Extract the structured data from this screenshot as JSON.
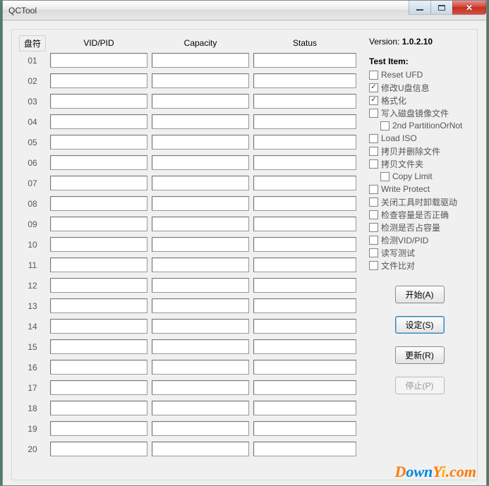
{
  "window": {
    "title": "QCTool"
  },
  "version_label": "Version:",
  "version_value": "1.0.2.10",
  "headers": {
    "drive": "盘符",
    "vidpid": "VID/PID",
    "capacity": "Capacity",
    "status": "Status"
  },
  "rows": [
    "01",
    "02",
    "03",
    "04",
    "05",
    "06",
    "07",
    "08",
    "09",
    "10",
    "11",
    "12",
    "13",
    "14",
    "15",
    "16",
    "17",
    "18",
    "19",
    "20"
  ],
  "test_header": "Test Item:",
  "checks": [
    {
      "label": "Reset UFD",
      "checked": false,
      "indent": false
    },
    {
      "label": "修改U盘信息",
      "checked": true,
      "indent": false
    },
    {
      "label": "格式化",
      "checked": true,
      "indent": false
    },
    {
      "label": "写入磁盘镜像文件",
      "checked": false,
      "indent": false
    },
    {
      "label": "2nd PartitionOrNot",
      "checked": false,
      "indent": true
    },
    {
      "label": "Load ISO",
      "checked": false,
      "indent": false
    },
    {
      "label": "拷贝并删除文件",
      "checked": false,
      "indent": false
    },
    {
      "label": "拷贝文件夹",
      "checked": false,
      "indent": false
    },
    {
      "label": "Copy Limit",
      "checked": false,
      "indent": true
    },
    {
      "label": "Write Protect",
      "checked": false,
      "indent": false
    },
    {
      "label": "关闭工具时卸载驱动",
      "checked": false,
      "indent": false
    },
    {
      "label": "检查容量是否正确",
      "checked": false,
      "indent": false
    },
    {
      "label": "检测是否占容量",
      "checked": false,
      "indent": false
    },
    {
      "label": "检测VID/PID",
      "checked": false,
      "indent": false
    },
    {
      "label": "读写测试",
      "checked": false,
      "indent": false
    },
    {
      "label": "文件比对",
      "checked": false,
      "indent": false
    }
  ],
  "buttons": {
    "start": "开始(A)",
    "settings": "设定(S)",
    "refresh": "更新(R)",
    "stop": "停止(P)"
  },
  "watermark": {
    "d": "D",
    "own": "own",
    "y": "Y",
    "i": "i",
    "com": ".com"
  }
}
